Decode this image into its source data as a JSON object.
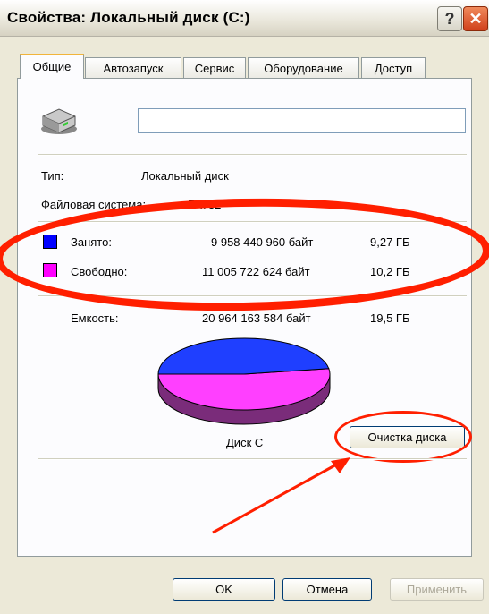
{
  "window": {
    "title": "Свойства: Локальный диск (C:)"
  },
  "tabs": [
    {
      "label": "Общие",
      "active": true
    },
    {
      "label": "Автозапуск"
    },
    {
      "label": "Сервис"
    },
    {
      "label": "Оборудование"
    },
    {
      "label": "Доступ"
    }
  ],
  "drive": {
    "name_value": "",
    "icon": "hard-drive-icon"
  },
  "info": {
    "type_label": "Тип:",
    "type_value": "Локальный диск",
    "fs_label": "Файловая система:",
    "fs_value": "FAT32"
  },
  "usage": {
    "used": {
      "label": "Занято:",
      "bytes": "9 958 440 960 байт",
      "size": "9,27 ГБ",
      "color": "#0000ff"
    },
    "free": {
      "label": "Свободно:",
      "bytes": "11 005 722 624 байт",
      "size": "10,2 ГБ",
      "color": "#ff00ff"
    },
    "capacity": {
      "label": "Емкость:",
      "bytes": "20 964 163 584 байт",
      "size": "19,5 ГБ"
    }
  },
  "pie": {
    "caption": "Диск C",
    "used_fraction": 0.475
  },
  "cleanup_button": "Очистка диска",
  "footer": {
    "ok": "OK",
    "cancel": "Отмена",
    "apply": "Применить"
  },
  "annotation_color": "#ff1f00"
}
